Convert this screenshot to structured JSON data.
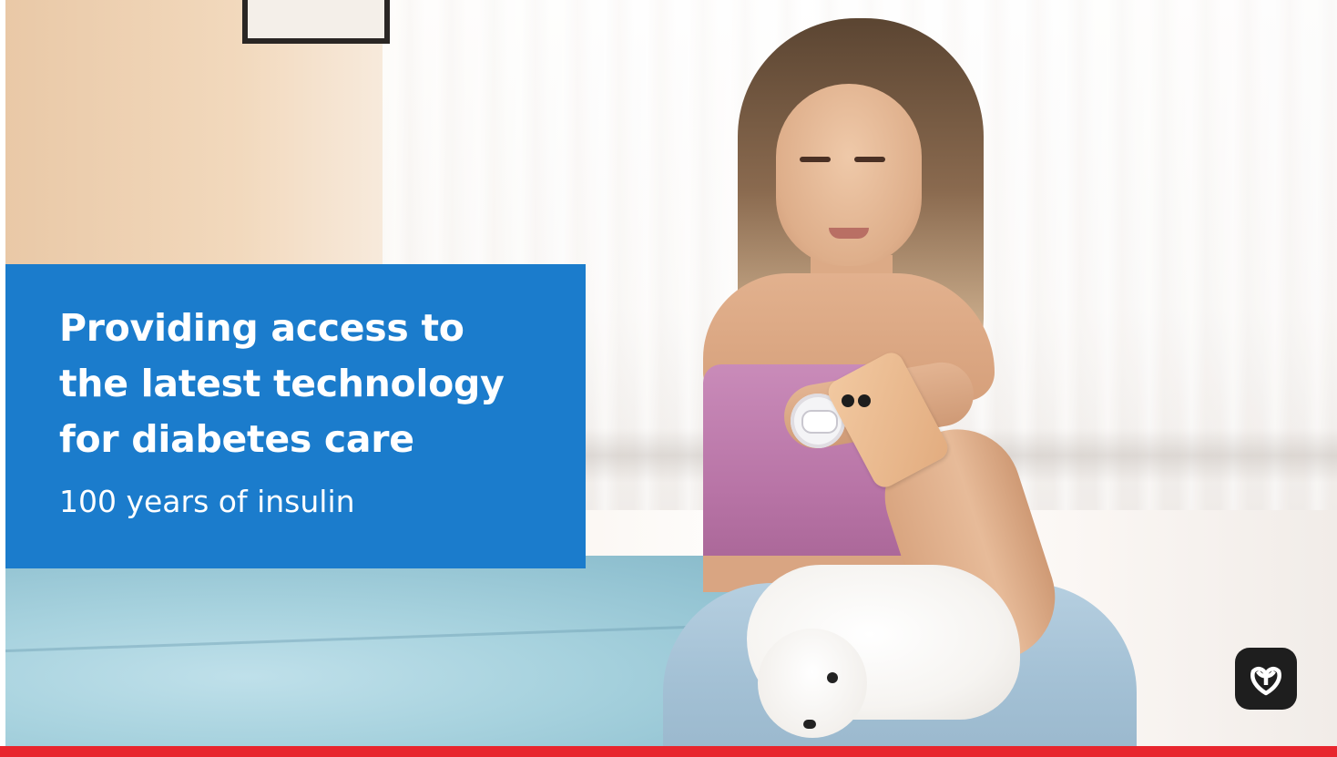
{
  "headline": "Providing access to\nthe latest technology\nfor diabetes care",
  "subheadline": "100 years of insulin",
  "logo": {
    "icon": "ontario-trillium-icon"
  },
  "colors": {
    "panel": "#1b7ccc",
    "text": "#ffffff",
    "accent_bar": "#e8262e",
    "logo_bg": "#1e1e1e"
  }
}
